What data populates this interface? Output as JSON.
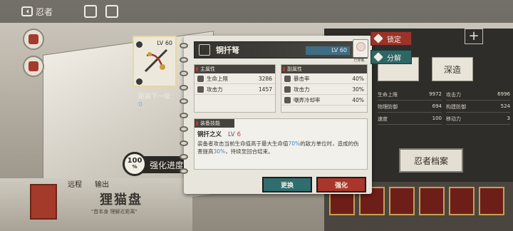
{
  "topbar": {
    "back_label": "忍者"
  },
  "background": {
    "bottom_tabs": [
      "远程",
      "输出"
    ],
    "cat_name": "狸猫盘",
    "cat_subtitle": "\"首本身 理解近距离\"",
    "right_tabs": [
      "",
      "深造"
    ],
    "right_stats": [
      {
        "name": "生命上限",
        "value": "9972"
      },
      {
        "name": "攻击力",
        "value": "6996"
      },
      {
        "name": "物理防御",
        "value": "694"
      },
      {
        "name": "构建防御",
        "value": "524"
      },
      {
        "name": "速度",
        "value": "100"
      },
      {
        "name": "移动力",
        "value": "3"
      }
    ],
    "card_label": "忍者档案"
  },
  "equip": {
    "level": "LV 60",
    "distance_label": "距离下一级:",
    "distance_value": "0"
  },
  "progress": {
    "percent_num": "100",
    "percent_sign": "%",
    "label": "强化进度"
  },
  "popup": {
    "title": "铜扦弩",
    "level": "LV 60",
    "equipped_tag": "已穿戴",
    "main_attr_header": "主属性",
    "sub_attr_header": "副属性",
    "main_attrs": [
      {
        "name": "生命上限",
        "value": "3286"
      },
      {
        "name": "攻击力",
        "value": "1457"
      }
    ],
    "sub_attrs": [
      {
        "name": "暴击率",
        "value": "40%"
      },
      {
        "name": "攻击力",
        "value": "30%"
      },
      {
        "name": "嘲弄冷却率",
        "value": "40%"
      }
    ],
    "skill_header": "装备技能",
    "skill_name": "铜扦之义",
    "skill_lv_label": "LV",
    "skill_lv": "6",
    "skill_desc_1": "装备者攻击当前生命值高于最大生命值",
    "skill_desc_pct1": "70%",
    "skill_desc_2": "的敌方单位时，造成的伤害提高",
    "skill_desc_pct2": "30%",
    "skill_desc_3": "，持续至回合结束。",
    "btn_swap": "更换",
    "btn_upgrade": "强化"
  },
  "side_actions": {
    "lock": "锁定",
    "decompose": "分解"
  },
  "colors": {
    "accent_red": "#a9362b",
    "accent_teal": "#2f6d6f",
    "highlight_blue": "#3b86c6"
  }
}
